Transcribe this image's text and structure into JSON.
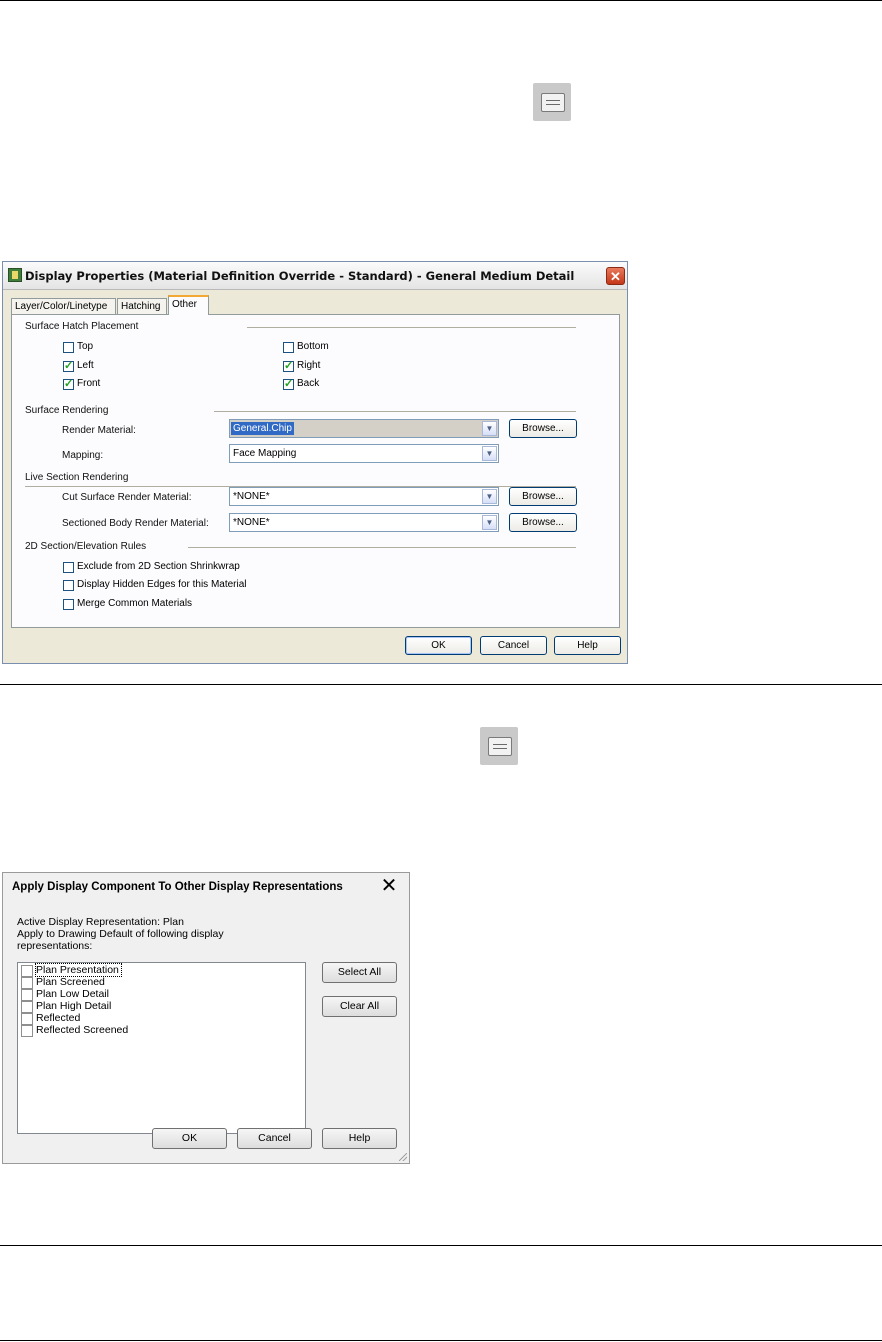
{
  "dialog1": {
    "title": "Display Properties (Material Definition Override - Standard) - General Medium Detail",
    "close_glyph": "✕",
    "tabs": [
      {
        "label": "Layer/Color/Linetype"
      },
      {
        "label": "Hatching"
      },
      {
        "label": "Other",
        "active": true
      }
    ],
    "surface_hatch": {
      "heading": "Surface Hatch Placement",
      "top": {
        "label": "Top",
        "checked": false
      },
      "left": {
        "label": "Left",
        "checked": true
      },
      "front": {
        "label": "Front",
        "checked": true
      },
      "bottom": {
        "label": "Bottom",
        "checked": false
      },
      "right": {
        "label": "Right",
        "checked": true
      },
      "back": {
        "label": "Back",
        "checked": true
      }
    },
    "surface_rendering": {
      "heading": "Surface Rendering",
      "render_material_label": "Render Material:",
      "render_material_value": "General.Chip",
      "mapping_label": "Mapping:",
      "mapping_value": "Face Mapping"
    },
    "live_section": {
      "heading": "Live Section Rendering",
      "cut_label": "Cut Surface Render Material:",
      "cut_value": "*NONE*",
      "sectioned_label": "Sectioned Body Render Material:",
      "sectioned_value": "*NONE*"
    },
    "section_rules": {
      "heading": "2D Section/Elevation Rules",
      "exclude": {
        "label": "Exclude from 2D Section Shrinkwrap",
        "checked": false
      },
      "hidden_edges": {
        "label": "Display Hidden Edges for this Material",
        "checked": false
      },
      "merge": {
        "label": "Merge Common Materials",
        "checked": false
      }
    },
    "browse_label": "Browse...",
    "buttons": {
      "ok": "OK",
      "cancel": "Cancel",
      "help": "Help"
    }
  },
  "dialog2": {
    "title": "Apply Display Component To Other Display Representations",
    "close_glyph": "✕",
    "active_rep": "Active Display Representation:  Plan",
    "apply_line1": "Apply to Drawing Default of following display",
    "apply_line2": "representations:",
    "items": [
      {
        "label": "Plan Presentation",
        "checked": false
      },
      {
        "label": "Plan Screened",
        "checked": false
      },
      {
        "label": "Plan Low Detail",
        "checked": false
      },
      {
        "label": "Plan High Detail",
        "checked": false
      },
      {
        "label": "Reflected",
        "checked": false
      },
      {
        "label": "Reflected Screened",
        "checked": false
      }
    ],
    "select_all": "Select All",
    "clear_all": "Clear All",
    "buttons": {
      "ok": "OK",
      "cancel": "Cancel",
      "help": "Help"
    }
  }
}
